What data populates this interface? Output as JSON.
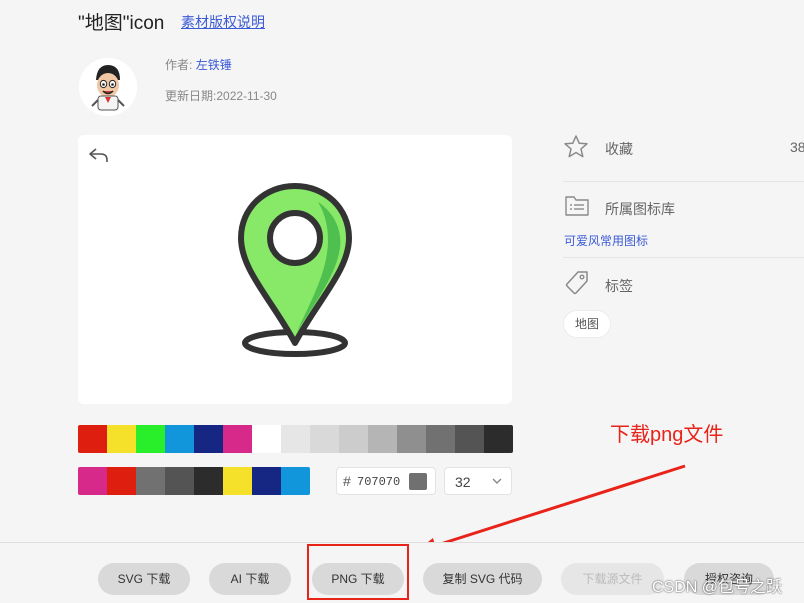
{
  "header": {
    "title": "\"地图\"icon",
    "license_link": "素材版权说明",
    "author_label": "作者:",
    "author_name": "左铁锤",
    "date_label": "更新日期:",
    "date_value": "2022-11-30"
  },
  "preview": {
    "icon": "map-pin",
    "pin_fill": "#88e868",
    "pin_shade": "#4fbf4f",
    "stroke": "#333333"
  },
  "palette": {
    "row1": [
      "#de1f10",
      "#f5e12a",
      "#29ef2a",
      "#1196dc",
      "#162683",
      "#d6298a",
      "#ffffff",
      "#e6e6e6",
      "#d9d9d9",
      "#cccccc",
      "#b5b5b5",
      "#8f8f8f",
      "#717171",
      "#545454",
      "#2c2c2c"
    ],
    "row2": [
      "#d6298a",
      "#de1f10",
      "#717171",
      "#545454",
      "#2c2c2c",
      "#f5e12a",
      "#162683",
      "#1196dc"
    ]
  },
  "color_input": {
    "hash": "#",
    "value": "707070",
    "swatch": "#707070"
  },
  "size_select": {
    "value": "32"
  },
  "sidebar": {
    "favorite_label": "收藏",
    "favorite_count": "38",
    "library_label": "所属图标库",
    "library_link": "可爱风常用图标",
    "tags_label": "标签",
    "tags": [
      "地图"
    ]
  },
  "annotation": {
    "text": "下载png文件",
    "color": "#e8231a"
  },
  "buttons": [
    {
      "label": "SVG 下载",
      "enabled": true
    },
    {
      "label": "AI 下载",
      "enabled": true
    },
    {
      "label": "PNG 下载",
      "enabled": true
    },
    {
      "label": "复制 SVG 代码",
      "enabled": true
    },
    {
      "label": "下载源文件",
      "enabled": false
    },
    {
      "label": "授权咨询",
      "enabled": true
    }
  ],
  "watermark": "CSDN @包号之跃"
}
